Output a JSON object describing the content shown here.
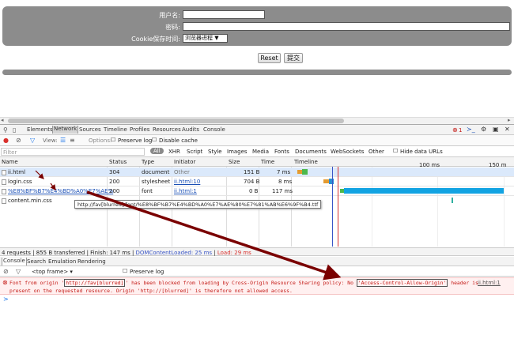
{
  "form": {
    "username_label": "用户名:",
    "password_label": "密码:",
    "cookie_label": "Cookie保存时间:",
    "cookie_select": "浏览器进程 ▼",
    "reset_label": "Reset",
    "submit_label": "提交"
  },
  "devtools": {
    "tabs": [
      "Elements",
      "Network",
      "Sources",
      "Timeline",
      "Profiles",
      "Resources",
      "Audits",
      "Console"
    ],
    "error_count": "1",
    "toolbar": {
      "view_label": "View:",
      "options_label": "Options:",
      "preserve_log": "Preserve log",
      "disable_cache": "Disable cache"
    },
    "filter_placeholder": "Filter",
    "filter_types": [
      "All",
      "XHR",
      "Script",
      "Style",
      "Images",
      "Media",
      "Fonts",
      "Documents",
      "WebSockets",
      "Other"
    ],
    "hide_data_urls": "Hide data URLs",
    "columns": {
      "name": "Name",
      "status": "Status",
      "type": "Type",
      "initiator": "Initiator",
      "size": "Size",
      "time": "Time",
      "timeline": "Timeline"
    },
    "timeline_ticks": [
      "100 ms",
      "150 m"
    ],
    "rows": [
      {
        "name": "ii.html",
        "status": "304",
        "type": "document",
        "initiator": "Other",
        "size": "151 B",
        "time": "7 ms"
      },
      {
        "name": "login.css",
        "status": "200",
        "type": "stylesheet",
        "initiator": "ii.html:10",
        "size": "704 B",
        "time": "8 ms"
      },
      {
        "name": "%E8%BF%B7%E4%BD%A0%E7%AE%",
        "status": "200",
        "type": "font",
        "initiator": "ii.html:1",
        "size": "0 B",
        "time": "117 ms"
      },
      {
        "name": "content.min.css",
        "status": "",
        "type": "",
        "initiator": "",
        "size": "",
        "time": ""
      }
    ],
    "tooltip": "http://fav[blurred]/font/%E8%BF%B7%E4%BD%A0%E7%AE%80%E7%81%AB%E6%9F%B4.ttf",
    "summary_main": "4 requests | 855 B transferred | Finish: 147 ms | ",
    "summary_dcl": "DOMContentLoaded: 25 ms",
    "summary_sep": " | ",
    "summary_load": "Load: 29 ms",
    "drawer_tabs": [
      "Console",
      "Search",
      "Emulation",
      "Rendering"
    ],
    "console_frame": "<top frame>",
    "console_preserve": "Preserve log",
    "error": {
      "part1": "Font from origin '",
      "origin1": "http://fav[blurred]",
      "part2": "' has been blocked from loading by Cross-Origin Resource Sharing policy: No ",
      "header": "'Access-Control-Allow-Origin'",
      "part3": " header is",
      "line2": "present on the requested resource. Origin 'http://[blurred]' is therefore not allowed access.",
      "source": "ii.html:1"
    },
    "prompt": ">"
  },
  "colors": {
    "accent": "#1a73e8",
    "error": "#c41a16",
    "annotation_arrow": "#7a0000"
  }
}
